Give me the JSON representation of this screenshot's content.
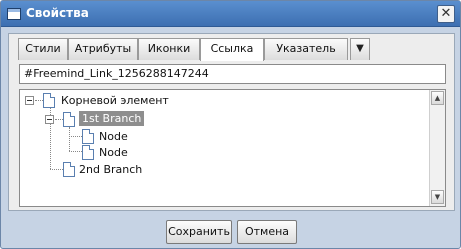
{
  "window": {
    "title": "Свойства",
    "close_label": "✕"
  },
  "tabs": [
    {
      "label": "Стили",
      "active": false
    },
    {
      "label": "Атрибуты",
      "active": false
    },
    {
      "label": "Иконки",
      "active": false
    },
    {
      "label": "Ссылка",
      "active": true
    },
    {
      "label": "Указатель",
      "active": false
    }
  ],
  "tabs_more_icon": "chevron-down-icon",
  "link_field": {
    "value": "#Freemind_Link_1256288147244"
  },
  "tree": {
    "root": "Корневой элемент",
    "branch1": "1st Branch",
    "child1": "Node",
    "child2": "Node",
    "branch2": "2nd Branch",
    "selected": "1st Branch"
  },
  "buttons": {
    "save": "Сохранить",
    "cancel": "Отмена"
  },
  "colors": {
    "titlebar": "#3d6fb1",
    "dialog_bg": "#c6d3e4",
    "selection": "#8e8e8e"
  }
}
